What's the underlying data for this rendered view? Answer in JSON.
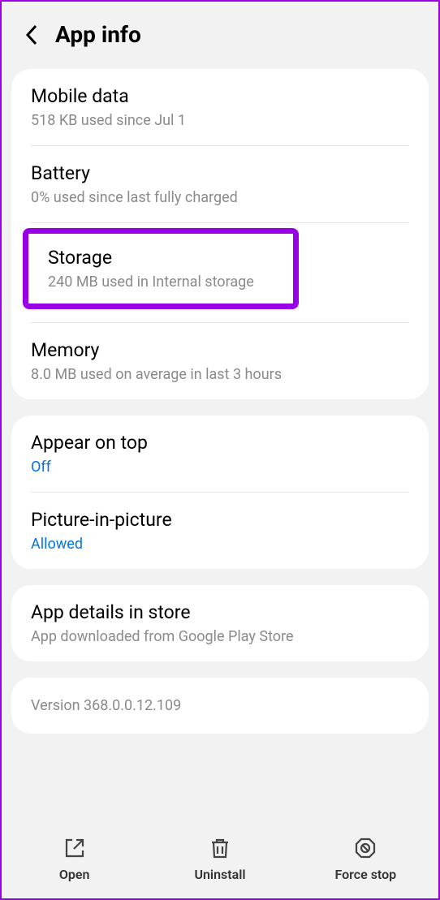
{
  "header": {
    "title": "App info"
  },
  "usage": {
    "mobile_data": {
      "title": "Mobile data",
      "sub": "518 KB used since Jul 1"
    },
    "battery": {
      "title": "Battery",
      "sub": "0% used since last fully charged"
    },
    "storage": {
      "title": "Storage",
      "sub": "240 MB used in Internal storage"
    },
    "memory": {
      "title": "Memory",
      "sub": "8.0 MB used on average in last 3 hours"
    }
  },
  "permissions": {
    "appear_on_top": {
      "title": "Appear on top",
      "status": "Off"
    },
    "pip": {
      "title": "Picture-in-picture",
      "status": "Allowed"
    }
  },
  "store": {
    "title": "App details in store",
    "sub": "App downloaded from Google Play Store"
  },
  "version": {
    "text": "Version 368.0.0.12.109"
  },
  "footer": {
    "open": "Open",
    "uninstall": "Uninstall",
    "force_stop": "Force stop"
  }
}
